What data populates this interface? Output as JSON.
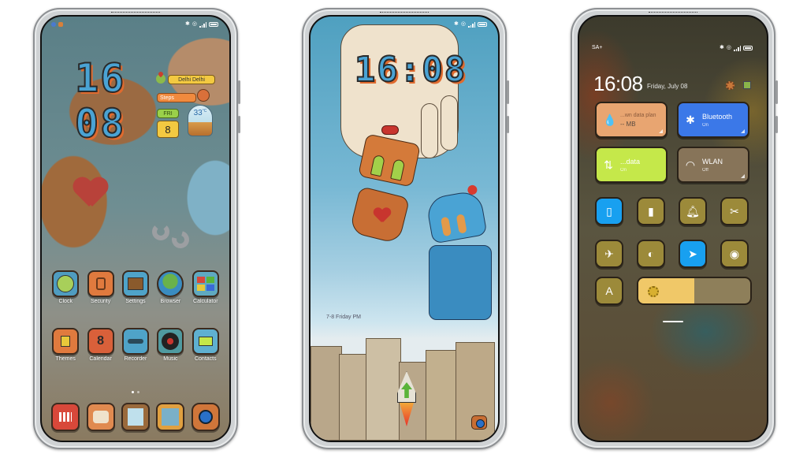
{
  "phones": {
    "home": {
      "status_left_icons": [
        "notification-icon",
        "app-icon"
      ],
      "status_right_icons": [
        "bluetooth-icon",
        "alarm-icon",
        "signal-icon",
        "battery-icon"
      ],
      "clock": {
        "hours": "16",
        "minutes": "08"
      },
      "widgets": {
        "city": "Delhi Delhi",
        "steps_label": "Steps",
        "day": "FRI",
        "date": "8",
        "temperature": "33",
        "temperature_unit": "°C"
      },
      "apps_row1": [
        {
          "label": "Clock",
          "icon": "clock-icon",
          "color": "#4f9cc0"
        },
        {
          "label": "Security",
          "icon": "security-icon",
          "color": "#e07a3e"
        },
        {
          "label": "Settings",
          "icon": "settings-icon",
          "color": "#4fa3c8"
        },
        {
          "label": "Browser",
          "icon": "browser-icon",
          "color": "#3a8cc0"
        },
        {
          "label": "Calculator",
          "icon": "calculator-icon",
          "color": "#5fa9c0"
        }
      ],
      "apps_row2": [
        {
          "label": "Themes",
          "icon": "themes-icon",
          "color": "#e07a3e"
        },
        {
          "label": "Calendar",
          "icon": "calendar-icon",
          "color": "#d9603a",
          "glyph": "8"
        },
        {
          "label": "Recorder",
          "icon": "recorder-icon",
          "color": "#4fa3c8"
        },
        {
          "label": "Music",
          "icon": "music-icon",
          "color": "#4f9aa0"
        },
        {
          "label": "Contacts",
          "icon": "contacts-icon",
          "color": "#5fb0d0"
        }
      ],
      "page_indicator": {
        "pages": 2,
        "current": 1
      },
      "dock": [
        {
          "icon": "phone-icon",
          "color": "#d8483a"
        },
        {
          "icon": "messages-icon",
          "color": "#e08a50"
        },
        {
          "icon": "notes-icon",
          "color": "#9a6a3c"
        },
        {
          "icon": "gallery-icon",
          "color": "#e0a040"
        },
        {
          "icon": "camera-icon",
          "color": "#d0763a"
        }
      ]
    },
    "lock": {
      "status_right_icons": [
        "bluetooth-icon",
        "alarm-icon",
        "signal-icon",
        "battery-icon"
      ],
      "clock": "16:08",
      "date_text": "7-8 Friday PM",
      "shortcut_icon": "camera-icon"
    },
    "control_center": {
      "carrier": "SA+",
      "status_right_icons": [
        "bluetooth-icon",
        "alarm-icon",
        "signal-icon",
        "battery-icon"
      ],
      "time": "16:08",
      "date": "Friday, July 08",
      "tiles": [
        {
          "id": "data-plan",
          "icon": "water-drop-icon",
          "title": "...wn data plan",
          "subtitle": "-- MB",
          "state": "neutral",
          "color": "#e8a571"
        },
        {
          "id": "bluetooth",
          "icon": "bluetooth-icon",
          "title": "Bluetooth",
          "subtitle": "On",
          "state": "on",
          "color": "#3b78e8"
        },
        {
          "id": "mobile-data",
          "icon": "data-arrows-icon",
          "title": "...data",
          "subtitle": "On",
          "state": "on",
          "color": "#c5e84a"
        },
        {
          "id": "wlan",
          "icon": "wifi-icon",
          "title": "WLAN",
          "subtitle": "Off",
          "state": "off",
          "color": "#877459"
        }
      ],
      "quick_toggles": [
        {
          "id": "vibrate",
          "icon": "vibrate-icon",
          "active": true
        },
        {
          "id": "flashlight",
          "icon": "flashlight-icon",
          "active": false
        },
        {
          "id": "mute",
          "icon": "bell-icon",
          "active": false
        },
        {
          "id": "screenshot",
          "icon": "screenshot-icon",
          "active": false
        },
        {
          "id": "airplane",
          "icon": "airplane-icon",
          "active": false
        },
        {
          "id": "dark-mode",
          "icon": "contrast-icon",
          "active": false
        },
        {
          "id": "location",
          "icon": "location-icon",
          "active": true
        },
        {
          "id": "reading-mode",
          "icon": "eye-icon",
          "active": false
        }
      ],
      "auto_brightness_label": "A",
      "brightness_percent": 50,
      "accent_active": "#18a0f0",
      "accent_inactive": "#9c8a3a"
    }
  }
}
